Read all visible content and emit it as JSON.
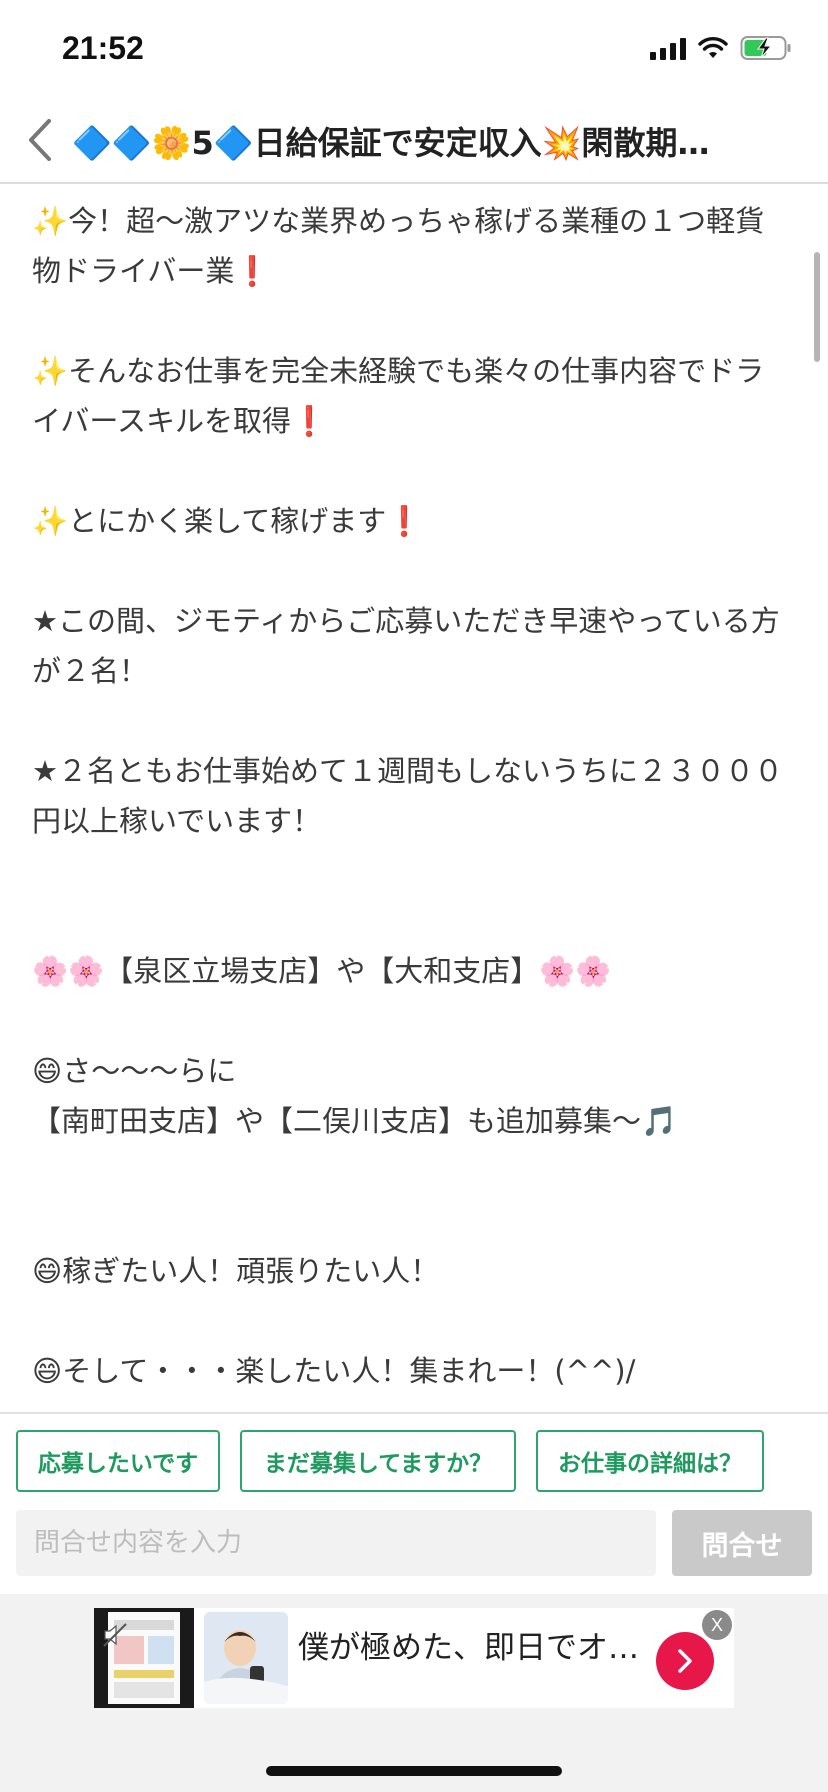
{
  "status_bar": {
    "time": "21:52",
    "icons": [
      "signal-icon",
      "wifi-icon",
      "battery-charging-icon"
    ]
  },
  "nav": {
    "back_icon": "chevron-left-icon",
    "title": "🔷🔷🌼5🔷日給保証で安定収入💥閑散期…"
  },
  "post": {
    "body": "✨今！超〜激アツな業界めっちゃ稼げる業種の１つ軽貨物ドライバー業❗\n\n✨そんなお仕事を完全未経験でも楽々の仕事内容でドライバースキルを取得❗\n\n✨とにかく楽して稼げます❗\n\n★この間、ジモティからご応募いただき早速やっている方が２名！\n\n★２名ともお仕事始めて１週間もしないうちに２３０００円以上稼いでいます！\n\n\n🌸🌸【泉区立場支店】や【大和支店】🌸🌸\n\n😄さ〜〜〜らに\n【南町田支店】や【二俣川支店】も追加募集〜🎵\n\n\n😄稼ぎたい人！頑張りたい人！\n\n😄そして・・・楽したい人！集まれー！(^^)/"
  },
  "quick_replies": [
    "応募したいです",
    "まだ募集してますか？",
    "お仕事の詳細は？"
  ],
  "inquiry": {
    "placeholder": "問合せ内容を入力",
    "button": "問合せ"
  },
  "ad": {
    "text": "僕が極めた、即日でオ…",
    "close": "X"
  },
  "colors": {
    "accent_green": "#1e9a5f",
    "ad_arrow": "#e8174a",
    "battery_green": "#34c759"
  }
}
